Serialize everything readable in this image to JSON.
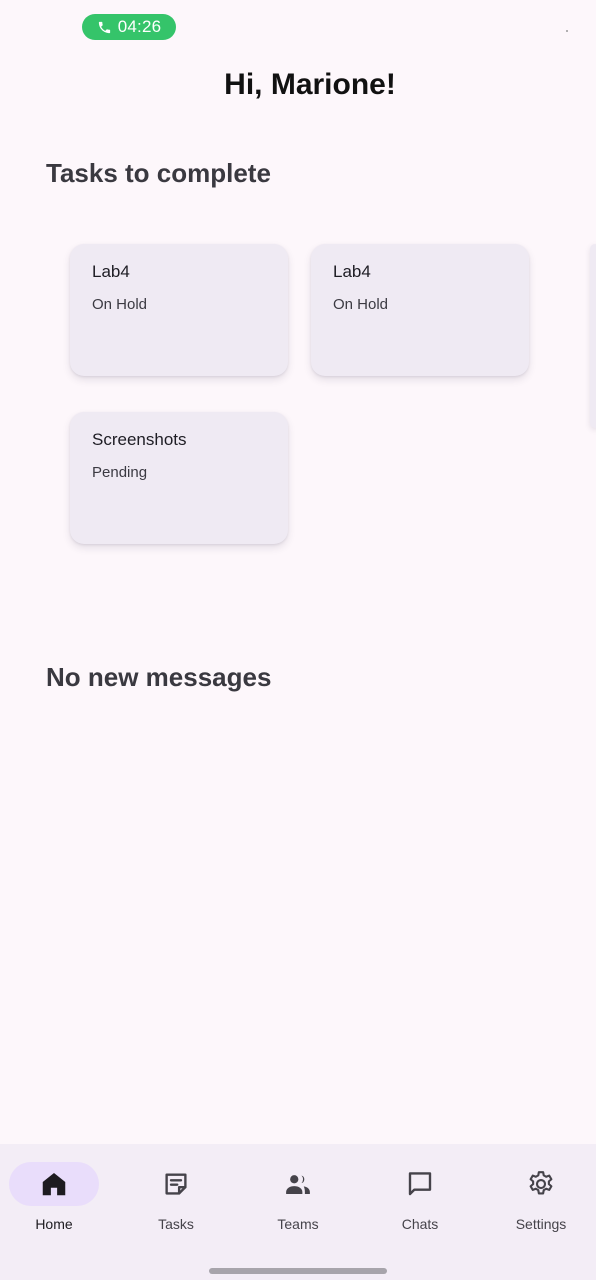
{
  "status_bar": {
    "call_time": "04:26",
    "call_color": "#35c46a"
  },
  "header": {
    "greeting": "Hi, Marione!"
  },
  "tasks_section": {
    "title": "Tasks to complete",
    "tasks": [
      {
        "name": "Lab4",
        "status": "On Hold"
      },
      {
        "name": "Lab4",
        "status": "On Hold"
      },
      {
        "name": "Screenshots",
        "status": "Pending"
      }
    ]
  },
  "messages_section": {
    "title": "No new messages"
  },
  "bottom_nav": {
    "active": "Home",
    "active_indicator_color": "#e9ddfb",
    "items": [
      {
        "label": "Home",
        "icon": "home-icon"
      },
      {
        "label": "Tasks",
        "icon": "note-icon"
      },
      {
        "label": "Teams",
        "icon": "people-icon"
      },
      {
        "label": "Chats",
        "icon": "chat-bubble-icon"
      },
      {
        "label": "Settings",
        "icon": "gear-icon"
      }
    ]
  }
}
